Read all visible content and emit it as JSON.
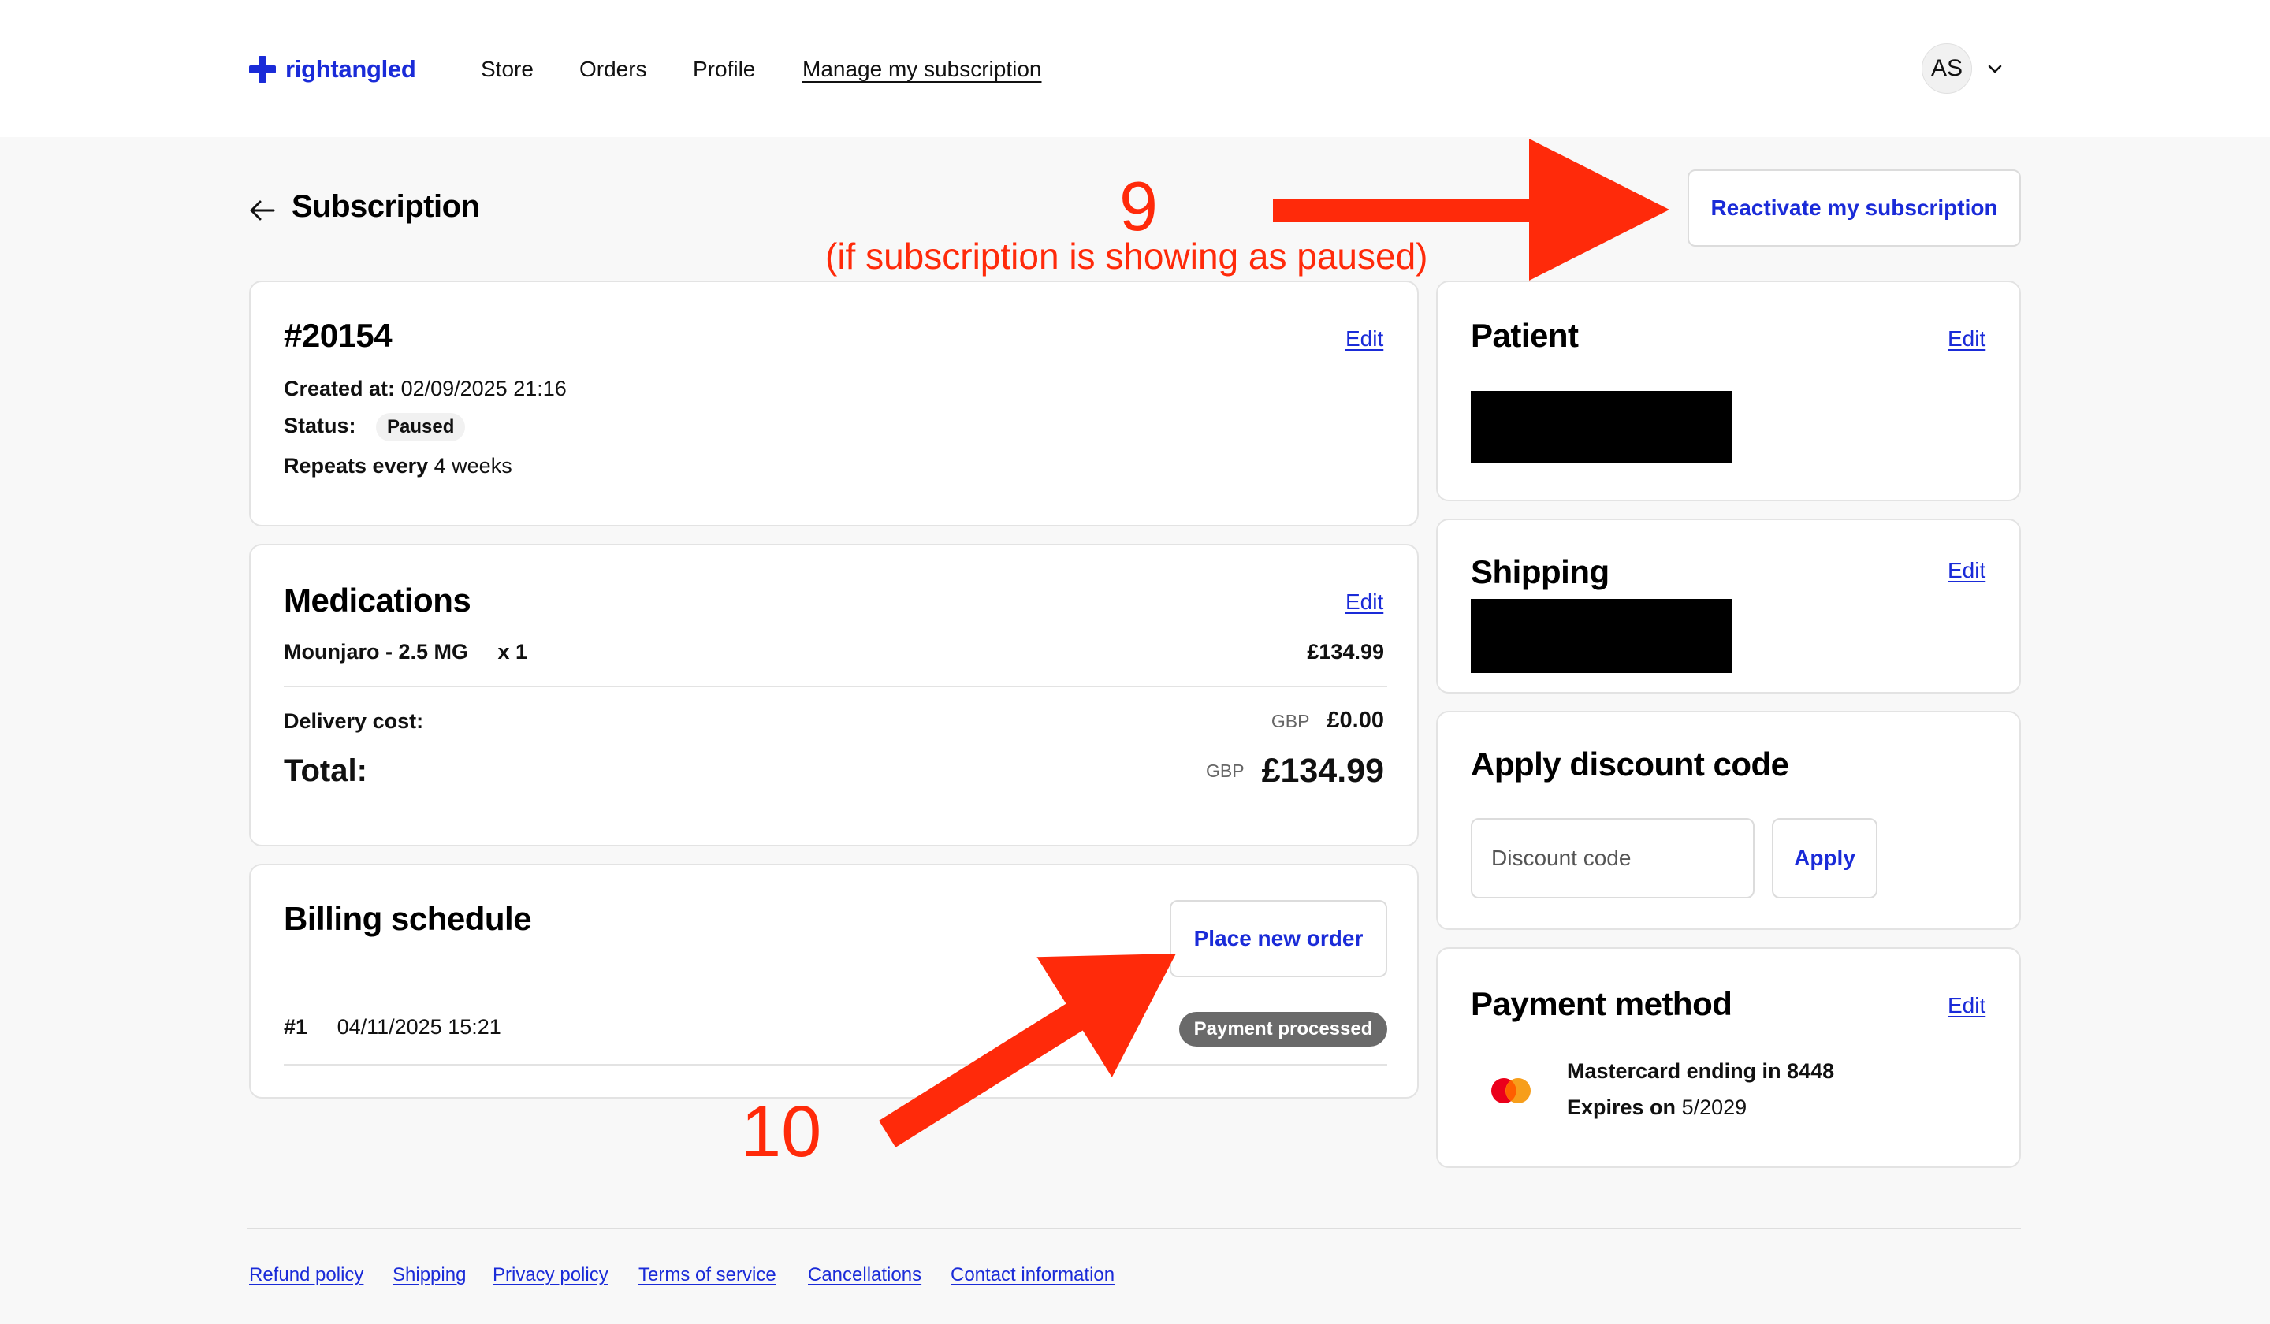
{
  "header": {
    "brand": "rightangled",
    "nav": [
      {
        "label": "Store"
      },
      {
        "label": "Orders"
      },
      {
        "label": "Profile"
      },
      {
        "label": "Manage my subscription"
      }
    ],
    "avatar_initials": "AS"
  },
  "page": {
    "title": "Subscription",
    "reactivate_label": "Reactivate my subscription"
  },
  "summary": {
    "id": "#20154",
    "edit": "Edit",
    "created_label": "Created at:",
    "created_value": "02/09/2025 21:16",
    "status_label": "Status:",
    "status_value": "Paused",
    "repeats_label": "Repeats every",
    "repeats_value": "4 weeks"
  },
  "medications": {
    "title": "Medications",
    "edit": "Edit",
    "item_name": "Mounjaro - 2.5 MG",
    "item_qty": "x 1",
    "item_price": "£134.99",
    "delivery_label": "Delivery cost:",
    "delivery_currency": "GBP",
    "delivery_value": "£0.00",
    "total_label": "Total:",
    "total_currency": "GBP",
    "total_value": "£134.99"
  },
  "billing": {
    "title": "Billing schedule",
    "place_order_label": "Place new order",
    "rows": [
      {
        "num": "#1",
        "date": "04/11/2025 15:21",
        "status": "Payment processed"
      }
    ]
  },
  "patient": {
    "title": "Patient",
    "edit": "Edit"
  },
  "shipping": {
    "title": "Shipping",
    "edit": "Edit"
  },
  "discount": {
    "title": "Apply discount code",
    "placeholder": "Discount code",
    "apply_label": "Apply"
  },
  "payment": {
    "title": "Payment method",
    "edit": "Edit",
    "card_line": "Mastercard ending in 8448",
    "expires_label": "Expires on",
    "expires_value": "5/2029"
  },
  "footer": {
    "links": [
      {
        "label": "Refund policy"
      },
      {
        "label": "Shipping"
      },
      {
        "label": "Privacy policy"
      },
      {
        "label": "Terms of service"
      },
      {
        "label": "Cancellations"
      },
      {
        "label": "Contact information"
      }
    ]
  },
  "annotations": {
    "step9_number": "9",
    "step9_note": "(if subscription is showing as paused)",
    "step10_number": "10",
    "color": "#ff2a0a"
  },
  "colors": {
    "accent": "#1a2bd8",
    "background": "#f8f8f8",
    "payment_pill": "#6a6a6a"
  }
}
